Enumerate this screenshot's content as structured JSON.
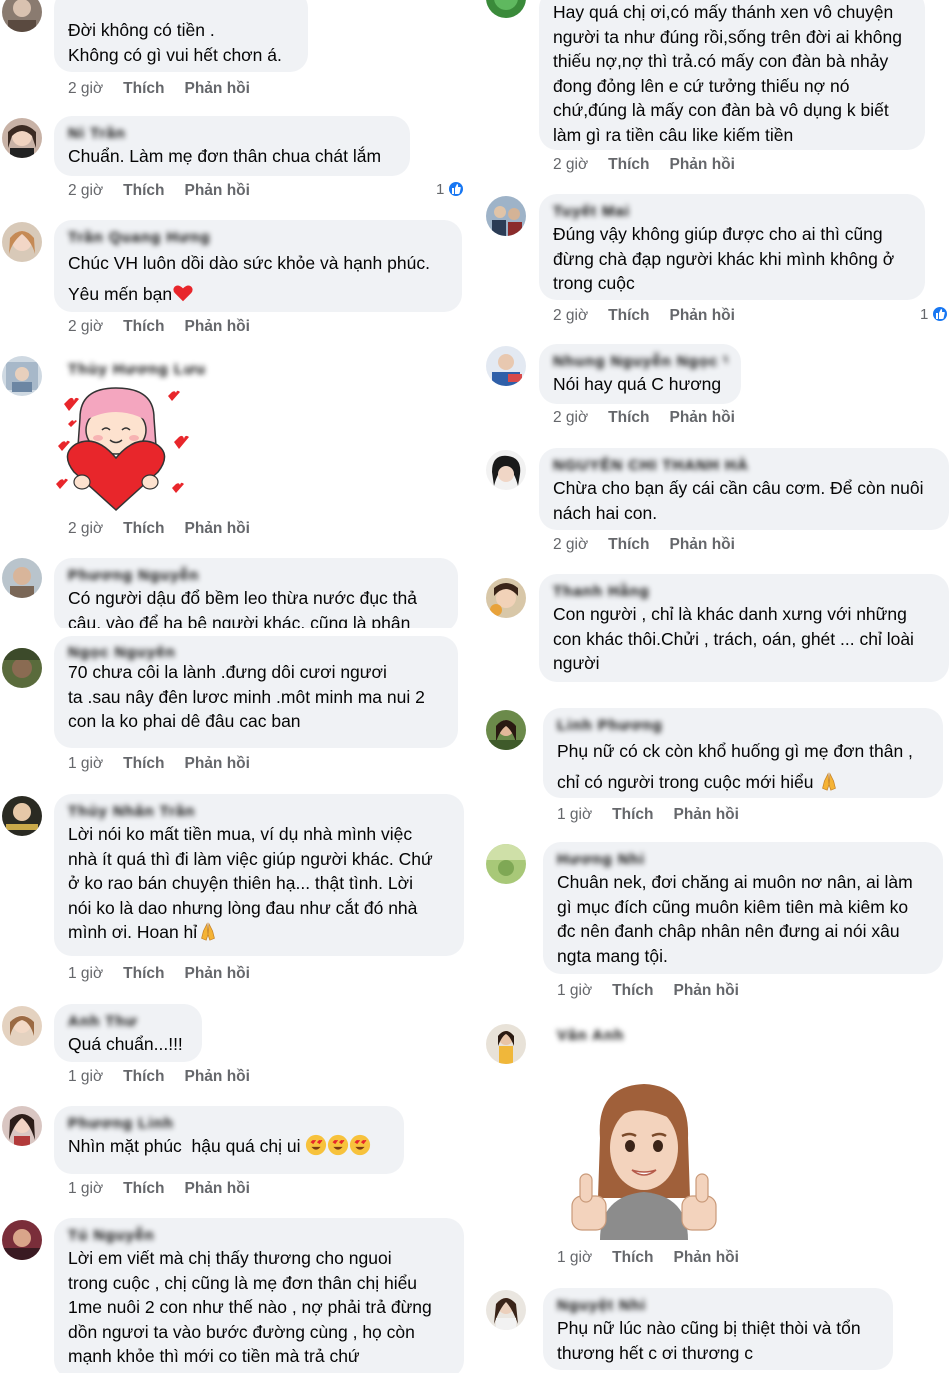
{
  "action_labels": {
    "like": "Thích",
    "reply": "Phản hồi"
  },
  "left_column": [
    {
      "id": "c1",
      "name": "",
      "text": "Đời không có tiền .\nKhông có gì vui hết chơn á.",
      "time": "2 giờ"
    },
    {
      "id": "c2",
      "name": "Ni Trần",
      "text": "Chuẩn. Làm mẹ đơn thân chua chát lắm",
      "time": "2 giờ",
      "reactions": "1"
    },
    {
      "id": "c3",
      "name": "Trần Quang Hưng",
      "text": "Chúc VH luôn dồi dào sức khỏe và hạnh phúc.\nYêu mến bạn",
      "time": "2 giờ",
      "emoji": "heart"
    },
    {
      "id": "c4",
      "name": "Thùy Hương Lưu",
      "text": "",
      "time": "2 giờ",
      "sticker": "girl-heart-sticker"
    },
    {
      "id": "c5",
      "name": "Phương Nguyễn",
      "text": "Có người dậu đổ bềm leo thừa nước đục thả\ncâu, vào để hạ bệ người khác, cũng là phận",
      "time": ""
    },
    {
      "id": "c6",
      "name": "Ngọc Nguyễn",
      "text": "70 chưa côi la lành .đưng dôi cươi ngươi\nta .sau nây đên lươc minh .môt minh ma nui 2\ncon la ko phai dê đâu cac ban",
      "time": "1 giờ"
    },
    {
      "id": "c7",
      "name": "Thủy Nhân Trần",
      "text": "Lời nói ko mất tiền mua, ví dụ nhà mình việc\nnhà ít quá thì đi làm việc giúp người khác. Chứ\nở ko rao bán chuyện thiên hạ... thật tình. Lời\nnói ko là dao nhưng lòng đau như cắt đó nhà\nmình ơi. Hoan hỉ",
      "time": "1 giờ",
      "emoji": "pray"
    },
    {
      "id": "c8",
      "name": "Anh Thư",
      "text": "Quá chuẩn...!!!",
      "time": "1 giờ"
    },
    {
      "id": "c9",
      "name": "Phương Linh",
      "text": "Nhìn mặt phúc  hậu quá chị ui",
      "time": "1 giờ",
      "emoji": "hearts3"
    },
    {
      "id": "c10",
      "name": "Tú Nguyễn",
      "text": "Lời em viết mà chị thấy thương cho nguoi\ntrong cuộc , chị cũng là mẹ đơn thân chị hiểu\n1me nuôi 2 con như thế nào , nợ phải trả đừng\ndồn ngươi ta vào bước đường cùng , họ còn\nmạnh khỏe thì mới co tiền mà trả chứ",
      "time": ""
    }
  ],
  "right_column": [
    {
      "id": "r1",
      "name": "",
      "text": "Hay quá chị ơi,có mấy thánh xen vô chuyện\nngười ta như đúng rồi,sống trên đời ai không\nthiếu nợ,nợ thì trả.có mấy con đàn bà nhảy\nđong đỏng lên e cứ tưởng thiếu nợ nó\nchứ,đúng là mấy con đàn bà vô dụng k biết\nlàm gì ra tiền câu like kiếm tiền",
      "time": "2 giờ"
    },
    {
      "id": "r2",
      "name": "Tuyết Mai",
      "text": "Đúng vậy không giúp được cho ai thì cũng\nđừng chà đạp người khác khi mình không ở\ntrong cuộc",
      "time": "2 giờ",
      "reactions": "1"
    },
    {
      "id": "r3",
      "name": "Nhung Nguyễn Ngọc Vy",
      "text": "Nói hay quá C hương",
      "time": "2 giờ"
    },
    {
      "id": "r4",
      "name": "NGUYỄN CHI THANH HÀ",
      "text": "Chừa cho bạn ấy cái cần câu cơm. Để còn nuôi\nnách hai con.",
      "time": "2 giờ"
    },
    {
      "id": "r5",
      "name": "Thanh Hằng",
      "text": "Con người , chỉ là khác danh xưng với những\ncon khác thôi.Chửi , trách, oán, ghét ... chỉ loài\nngười",
      "time": ""
    },
    {
      "id": "r6",
      "name": "Linh Phương",
      "text": "Phụ nữ có ck còn khổ huống gì mẹ đơn thân ,\nchỉ có người trong cuộc mới hiểu",
      "time": "1 giờ",
      "emoji": "pray"
    },
    {
      "id": "r7",
      "name": "Hương Nhi",
      "text": "Chuân nek, đơi chăng ai muôn nơ nân, ai làm\ngì mục đích cũng muôn kiêm tiên mà kiêm ko\nđc nên đanh châp nhân nên đưng ai nói xâu\nngta mang tội.",
      "time": "1 giờ"
    },
    {
      "id": "r8",
      "name": "Vân Anh",
      "text": "",
      "time": "1 giờ",
      "sticker": "thumbs-up-avatar-sticker"
    },
    {
      "id": "r9",
      "name": "Nguyệt Nhi",
      "text": "Phụ nữ lúc nào cũng bị thiệt thòi và tổn\nthương hết c ơi thương c",
      "time": ""
    }
  ]
}
